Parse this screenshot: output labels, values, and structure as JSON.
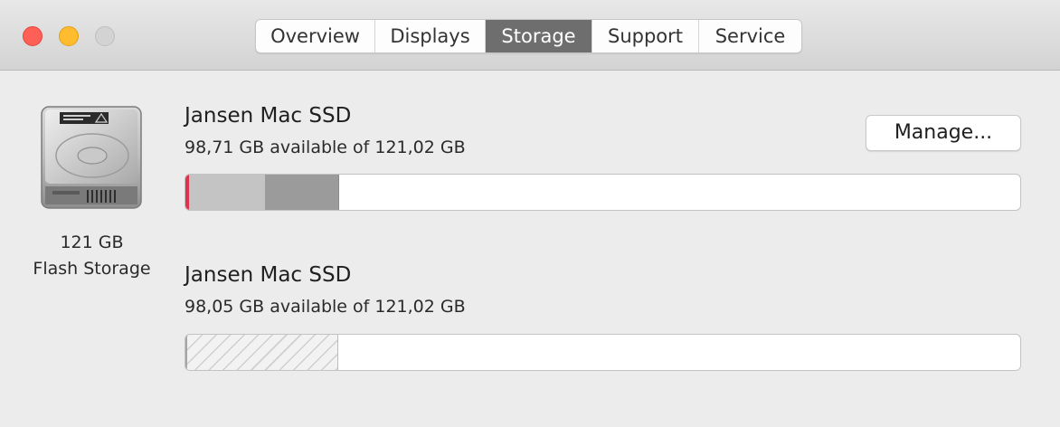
{
  "window": {
    "controls": [
      "close",
      "minimize",
      "zoom"
    ]
  },
  "tabs": [
    {
      "label": "Overview",
      "active": false
    },
    {
      "label": "Displays",
      "active": false
    },
    {
      "label": "Storage",
      "active": true
    },
    {
      "label": "Support",
      "active": false
    },
    {
      "label": "Service",
      "active": false
    }
  ],
  "disk": {
    "icon": "hard-drive-icon",
    "size_label": "121 GB",
    "type_label": "Flash Storage"
  },
  "volumes": [
    {
      "name": "Jansen Mac SSD",
      "availability": "98,71 GB available of 121,02 GB",
      "used_fraction": 0.184,
      "segment_colors": [
        "#e0324a",
        "#c4c4c4",
        "#9b9b9b"
      ]
    },
    {
      "name": "Jansen Mac SSD",
      "availability": "98,05 GB available of 121,02 GB",
      "used_fraction": 0.19,
      "segment_colors": [
        "#cfcfcf"
      ]
    }
  ],
  "manage_button": {
    "label": "Manage..."
  },
  "colors": {
    "active_tab": "#6e6e6e",
    "close": "#fe5f57",
    "minimize": "#febc2e",
    "zoom_disabled": "#d3d3d3"
  }
}
